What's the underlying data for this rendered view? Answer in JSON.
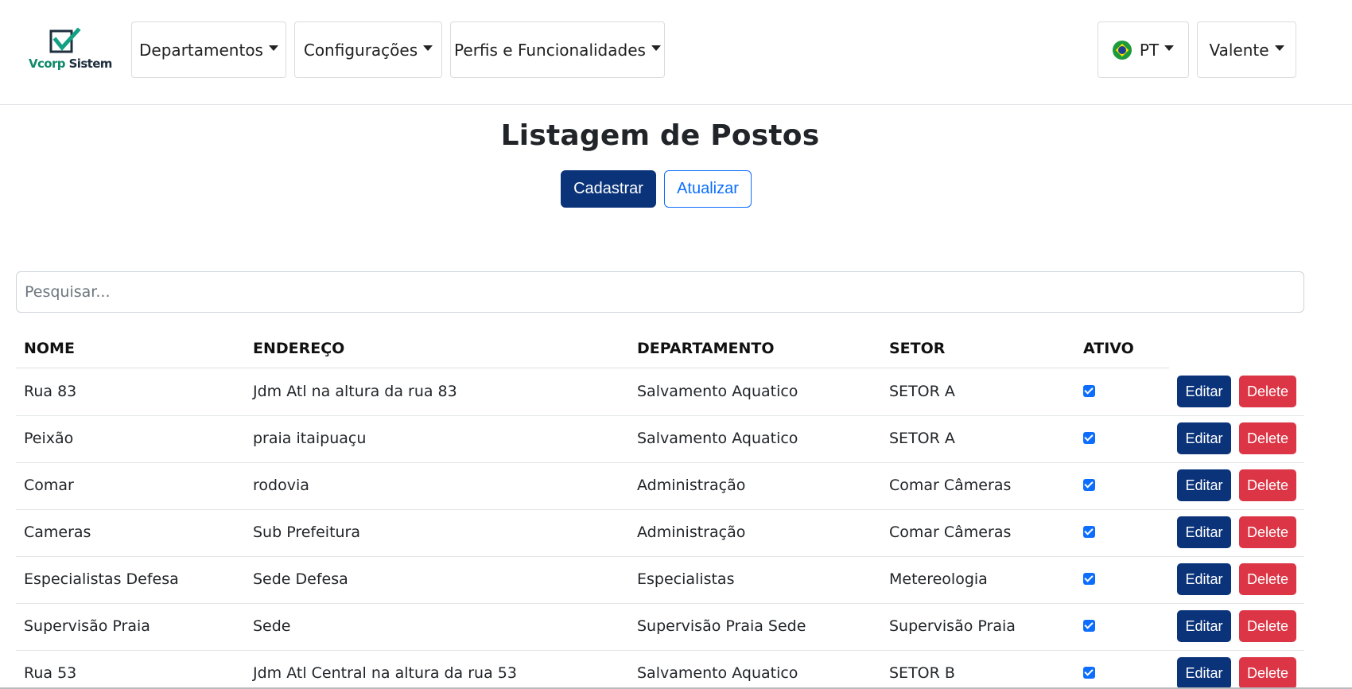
{
  "brand": {
    "logo_word1": "Vcorp",
    "logo_word2": "Sistem",
    "icon": "check-square-logo-icon",
    "colors": {
      "check": "#13a084",
      "box": "#1e2f3e"
    }
  },
  "nav": {
    "departamentos": "Departamentos",
    "configuracoes": "Configurações",
    "perfis": "Perfis e Funcionalidades",
    "language": "PT",
    "language_icon": "brazil-flag-icon",
    "user": "Valente"
  },
  "page": {
    "title": "Listagem de Postos",
    "create_label": "Cadastrar",
    "refresh_label": "Atualizar"
  },
  "search": {
    "placeholder": "Pesquisar...",
    "value": ""
  },
  "table": {
    "headers": [
      "NOME",
      "ENDEREÇO",
      "DEPARTAMENTO",
      "SETOR",
      "ATIVO"
    ],
    "edit_label": "Editar",
    "delete_label": "Delete",
    "rows": [
      {
        "nome": "Rua 83",
        "endereco": "Jdm Atl na altura da rua 83",
        "departamento": "Salvamento Aquatico",
        "setor": "SETOR A",
        "ativo": true
      },
      {
        "nome": "Peixão",
        "endereco": "praia itaipuaçu",
        "departamento": "Salvamento Aquatico",
        "setor": "SETOR A",
        "ativo": true
      },
      {
        "nome": "Comar",
        "endereco": "rodovia",
        "departamento": "Administração",
        "setor": "Comar Câmeras",
        "ativo": true
      },
      {
        "nome": "Cameras",
        "endereco": "Sub Prefeitura",
        "departamento": "Administração",
        "setor": "Comar Câmeras",
        "ativo": true
      },
      {
        "nome": "Especialistas Defesa",
        "endereco": "Sede Defesa",
        "departamento": "Especialistas",
        "setor": "Metereologia",
        "ativo": true
      },
      {
        "nome": "Supervisão Praia",
        "endereco": "Sede",
        "departamento": "Supervisão Praia Sede",
        "setor": "Supervisão Praia",
        "ativo": true
      },
      {
        "nome": "Rua 53",
        "endereco": "Jdm Atl Central na altura da rua 53",
        "departamento": "Salvamento Aquatico",
        "setor": "SETOR B",
        "ativo": true
      }
    ]
  },
  "colors": {
    "primary": "#0a337a",
    "outline": "#0d6efd",
    "danger": "#dc3545"
  }
}
